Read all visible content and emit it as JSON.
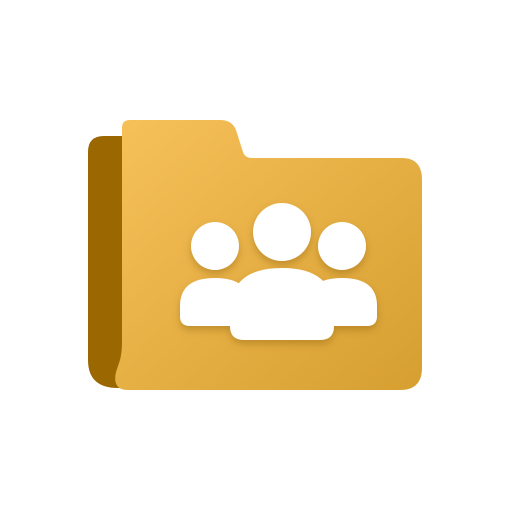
{
  "icon": {
    "name": "shared-folder-icon",
    "glyph": "people-group-icon"
  },
  "colors": {
    "background": "#ffffff",
    "folder_back": "#9a6700",
    "folder_front_light": "#f7c15a",
    "folder_front_dark": "#d69f30",
    "people_fill": "#ffffff",
    "shadow": "#7a4f00"
  }
}
